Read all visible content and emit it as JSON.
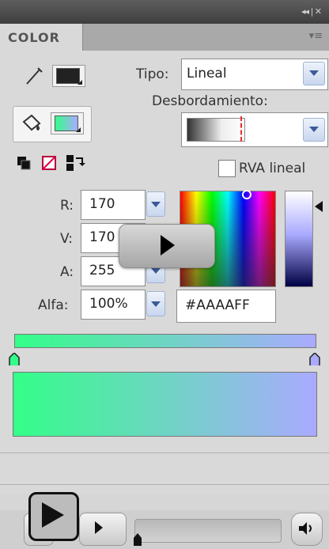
{
  "panel": {
    "tab_label": "COLOR",
    "collapse_glyph": "◂◂ | ✕",
    "menu_glyph": "▾≡"
  },
  "colors": {
    "stroke": "#222222",
    "fill_gradient_start": "#33ff88",
    "fill_gradient_end": "#aaaaff",
    "selected": "#AAAAFF"
  },
  "fill_type": {
    "label": "Tipo:",
    "value": "Lineal"
  },
  "overflow": {
    "label": "Desbordamiento:"
  },
  "linear_rgb": {
    "label": "RVA lineal",
    "checked": false
  },
  "rgb": {
    "r": {
      "label": "R:",
      "value": "170"
    },
    "g": {
      "label": "V:",
      "value": "170"
    },
    "b": {
      "label": "A:",
      "value": "255"
    },
    "alpha": {
      "label": "Alfa:",
      "value": "100%"
    }
  },
  "hex": {
    "value": "#AAAAFF"
  },
  "icons": {
    "stroke": "pencil-icon",
    "fill": "paint-bucket-icon",
    "black_white": "black-white-icon",
    "no_color": "no-color-icon",
    "swap": "swap-colors-icon"
  },
  "player": {
    "play_overlay": "play-icon",
    "sound": "speaker-icon"
  }
}
